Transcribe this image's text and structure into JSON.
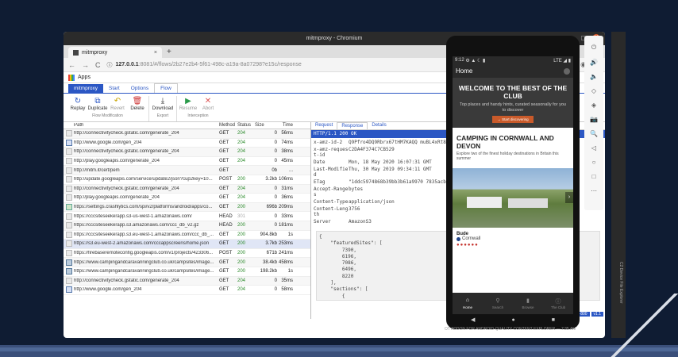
{
  "window": {
    "title": "mitmproxy - Chromium",
    "min": "–",
    "max": "◻",
    "close": "✕"
  },
  "browser": {
    "tab_title": "mitmproxy",
    "tab_close": "×",
    "new_tab": "+",
    "url_host": "127.0.0.1",
    "url_rest": ":8081/#/flows/2b27e2b4-5f61-498c-a19a-8a07298?e15c/response",
    "bookmarks_label": "Apps"
  },
  "menu": {
    "brand": "mitmproxy",
    "items": [
      "Start",
      "Options",
      "Flow"
    ]
  },
  "toolbar": {
    "groups": [
      {
        "label": "Flow Modification",
        "buttons": [
          {
            "icon": "↻",
            "label": "Replay"
          },
          {
            "icon": "⧉",
            "label": "Duplicate"
          },
          {
            "icon": "↶",
            "label": "Revert"
          },
          {
            "icon": "🗑",
            "label": "Delete"
          }
        ]
      },
      {
        "label": "Export",
        "buttons": [
          {
            "icon": "⤓",
            "label": "Download"
          }
        ]
      },
      {
        "label": "Interception",
        "buttons": [
          {
            "icon": "▶",
            "label": "Resume"
          },
          {
            "icon": "✕",
            "label": "Abort"
          }
        ]
      }
    ]
  },
  "flow_table": {
    "headers": {
      "path": "Path",
      "method": "Method",
      "status": "Status",
      "size": "Size",
      "time": "Time"
    },
    "rows": [
      {
        "icon": "plain",
        "path": "http://connectivitycheck.gstatic.com/generate_204",
        "method": "GET",
        "status": "204",
        "size": "0",
        "time": "56ms"
      },
      {
        "icon": "code",
        "path": "http://www.google.com/gen_204",
        "method": "GET",
        "status": "204",
        "size": "0",
        "time": "74ms"
      },
      {
        "icon": "plain",
        "path": "http://connectivitycheck.gstatic.com/generate_204",
        "method": "GET",
        "status": "204",
        "size": "0",
        "time": "38ms"
      },
      {
        "icon": "plain",
        "path": "http://play.googleapis.com/generate_204",
        "method": "GET",
        "status": "204",
        "size": "0",
        "time": "45ms"
      },
      {
        "icon": "plain",
        "path": "http://mitm.it/cert/pem",
        "method": "GET",
        "status": "",
        "size": "0b",
        "time": "..."
      },
      {
        "icon": "plain",
        "path": "http://update.googleapis.com/service/update2/json?cup2key=10...",
        "method": "POST",
        "status": "200",
        "size": "3.2kb",
        "time": "106ms"
      },
      {
        "icon": "plain",
        "path": "http://connectivitycheck.gstatic.com/generate_204",
        "method": "GET",
        "status": "204",
        "size": "0",
        "time": "31ms"
      },
      {
        "icon": "plain",
        "path": "http://play.googleapis.com/generate_204",
        "method": "GET",
        "status": "204",
        "size": "0",
        "time": "36ms"
      },
      {
        "icon": "js",
        "path": "https://settings.crashlytics.com/spi/v2/platforms/android/apps/co...",
        "method": "GET",
        "status": "200",
        "size": "696b",
        "time": "209ms"
      },
      {
        "icon": "plain",
        "path": "https://cccsiteseekerapp.s3-us-west-1.amazonaws.com/",
        "method": "HEAD",
        "status": "301",
        "size": "0",
        "time": "33ms"
      },
      {
        "icon": "plain",
        "path": "https://cccsiteseekerapp.s3.amazonaws.com/ccc_db_v2.gz",
        "method": "HEAD",
        "status": "200",
        "size": "0",
        "time": "181ms"
      },
      {
        "icon": "plain",
        "path": "https://cccsiteseekerapp.s3.eu-west-1.amazonaws.com/ccc_db_...",
        "method": "GET",
        "status": "200",
        "size": "904.8kb",
        "time": "1s"
      },
      {
        "icon": "plain",
        "path": "https://s3.eu-west-2.amazonaws.com/cccappscreens/home.json",
        "method": "GET",
        "status": "200",
        "size": "3.7kb",
        "time": "253ms",
        "selected": true
      },
      {
        "icon": "plain",
        "path": "https://firebaseremoteconfig.googleapis.com/v1/projects/423306...",
        "method": "POST",
        "status": "200",
        "size": "671b",
        "time": "241ms"
      },
      {
        "icon": "img",
        "path": "https://www.campingandcaravanningclub.co.uk/campsites/image...",
        "method": "GET",
        "status": "200",
        "size": "38.4kb",
        "time": "458ms"
      },
      {
        "icon": "img",
        "path": "https://www.campingandcaravanningclub.co.uk/campsites/image...",
        "method": "GET",
        "status": "200",
        "size": "198.2kb",
        "time": "1s"
      },
      {
        "icon": "plain",
        "path": "http://connectivitycheck.gstatic.com/generate_204",
        "method": "GET",
        "status": "204",
        "size": "0",
        "time": "35ms"
      },
      {
        "icon": "code",
        "path": "http://www.google.com/gen_204",
        "method": "GET",
        "status": "204",
        "size": "0",
        "time": "58ms"
      }
    ]
  },
  "detail": {
    "tabs": [
      "Request",
      "Response",
      "Details"
    ],
    "active_tab": "Response",
    "status_line": "HTTP/1.1 200 OK",
    "headers": [
      {
        "k": "x-amz-id-2",
        "v": "Q9Pfro4DQ9Rbrx67tHM7KAQQ muBL4xRt8qZuidNi2il20F0LYV 7q2ywFdAgVMiu1B6XWAQATU="
      },
      {
        "k": "x-amz-reques t-id",
        "v": "C2DA4F374C7CB529"
      },
      {
        "k": "Date",
        "v": "Mon, 18 May 2020 16:07:31 GMT"
      },
      {
        "k": "Last-Modifie d",
        "v": "Thu, 30 May 2019 09:34:11 GMT"
      },
      {
        "k": "ETag",
        "v": "\"1ddc5974868b39bb3b61a9970 7835acb\""
      },
      {
        "k": "Accept-Range s",
        "v": "bytes"
      },
      {
        "k": "Content-Type",
        "v": "application/json"
      },
      {
        "k": "Content-Leng th",
        "v": "3756"
      },
      {
        "k": "Server",
        "v": "AmazonS3"
      }
    ],
    "body": "{\n    \"featuredSites\": [\n        7390,\n        6196,\n        7086,\n        6496,\n        8220\n    ],\n    \"sections\": [\n        {",
    "edit_icon": "✎",
    "badge1": "+800",
    "badge2": "v1.1"
  },
  "phone": {
    "status_time": "9:12",
    "status_icons": "⚙ ▲ ☾ ▮",
    "status_right": "LTE ◢ ▮",
    "app_title": "Home",
    "hero_title": "WELCOME TO THE BEST OF THE CLUB",
    "hero_sub": "Top places and handy hints, curated seasonally for you to discover",
    "hero_btn": "→ Start discovering",
    "card_title": "CAMPING IN CORNWALL AND DEVON",
    "card_desc": "Explore two of the finest holiday destinations in Britain this summer",
    "arrow": "›",
    "loc_name": "Bude",
    "loc_region": "Cornwall",
    "stars": "●●●●●●",
    "nav": [
      {
        "icon": "⌂",
        "label": "Home"
      },
      {
        "icon": "⚲",
        "label": "Search"
      },
      {
        "icon": "▮",
        "label": "Browse"
      },
      {
        "icon": "ⓘ",
        "label": "The Club"
      }
    ],
    "sys_back": "◀",
    "sys_home": "●",
    "sys_recent": "■"
  },
  "emulator": {
    "icons": [
      "⏻",
      "🔊",
      "🔈",
      "◇",
      "◈",
      "📷",
      "🔍",
      "◁",
      "○",
      "□",
      "⋯"
    ]
  },
  "side_text": "C2 Device File Explorer",
  "overlay": "OT ADDON FOR ANDROID-QUALITY CONTENT EXPLORER — 7:35 AM"
}
